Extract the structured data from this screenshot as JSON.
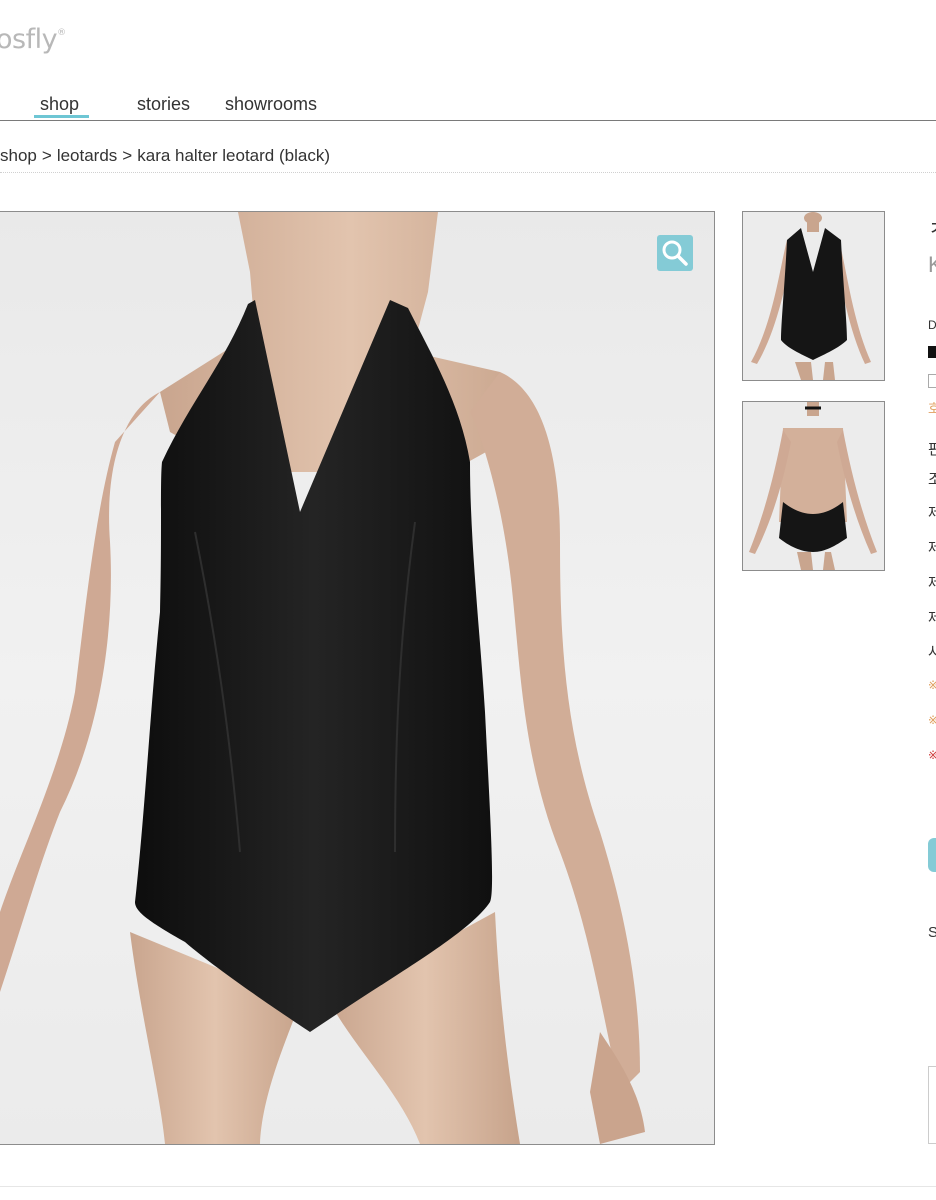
{
  "header": {
    "logo_text": "osfly",
    "logo_mark": "®"
  },
  "nav": {
    "items": [
      {
        "label": "shop",
        "active": true
      },
      {
        "label": "stories"
      },
      {
        "label": "showrooms"
      }
    ],
    "accent_color": "#6ec6d4"
  },
  "breadcrumb": {
    "items": [
      "shop",
      "leotards",
      "kara halter leotard (black)"
    ],
    "separator": ">"
  },
  "product": {
    "name": "kara halter leotard (black)",
    "color": "black",
    "zoom_icon": "magnifier-icon"
  },
  "right_column": {
    "title_partial": "ㅊ",
    "subtitle_partial": "K",
    "label_d": "D",
    "label_ho": "호",
    "row_1": "판",
    "row_2": "조",
    "row_3": "제",
    "row_4": "제",
    "row_5": "제",
    "row_6": "제",
    "row_7": "사",
    "note_1": "※",
    "note_2": "※",
    "note_3": "※",
    "label_s": "S"
  }
}
